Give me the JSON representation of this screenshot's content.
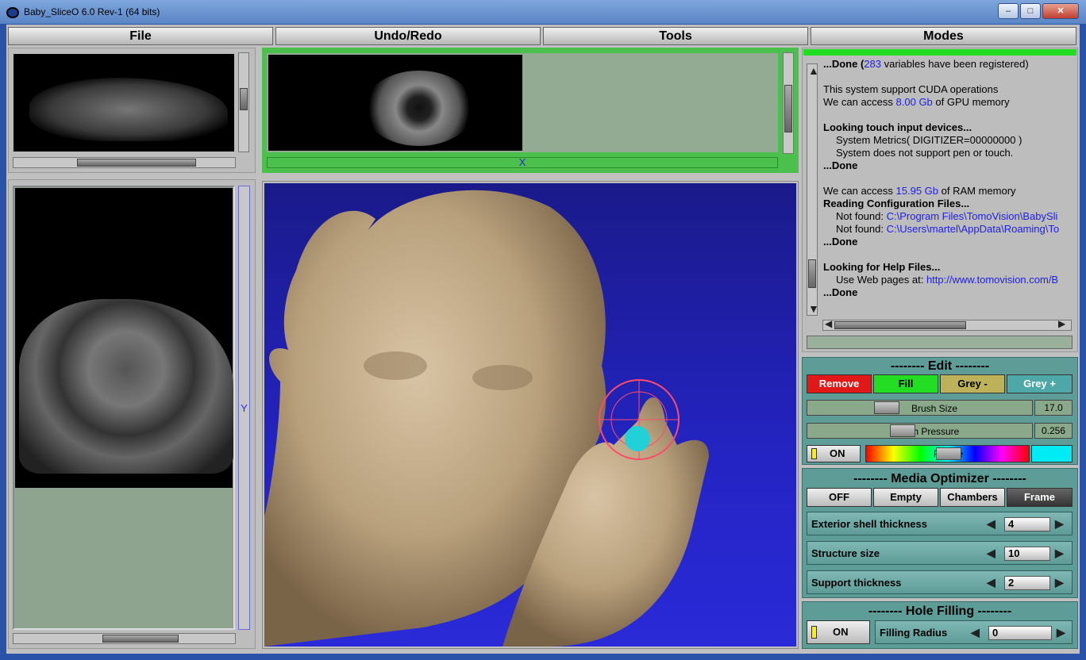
{
  "window": {
    "title": "Baby_SliceO 6.0 Rev-1 (64 bits)"
  },
  "menu": [
    "File",
    "Undo/Redo",
    "Tools",
    "Modes"
  ],
  "views": {
    "axis_y": "Y",
    "axis_x": "X"
  },
  "log": [
    {
      "bold": true,
      "text": "...Done (",
      "blue": "283",
      "rest": " variables have been registered)"
    },
    {
      "text": ""
    },
    {
      "text": "This system support CUDA operations"
    },
    {
      "text": "We can access ",
      "blue": "8.00 Gb",
      "rest": " of GPU memory"
    },
    {
      "text": ""
    },
    {
      "bold": true,
      "text": "Looking touch input devices..."
    },
    {
      "indent": true,
      "text": "System Metrics( DIGITIZER=00000000 )"
    },
    {
      "indent": true,
      "text": "System does not support pen or touch."
    },
    {
      "bold": true,
      "text": "...Done"
    },
    {
      "text": ""
    },
    {
      "text": "We can access ",
      "blue": "15.95 Gb",
      "rest": " of RAM memory"
    },
    {
      "bold": true,
      "text": "Reading Configuration Files..."
    },
    {
      "indent": true,
      "text": "Not found: ",
      "blue": "C:\\Program Files\\TomoVision\\BabySli"
    },
    {
      "indent": true,
      "text": "Not found: ",
      "blue": "C:\\Users\\martel\\AppData\\Roaming\\To"
    },
    {
      "bold": true,
      "text": "...Done"
    },
    {
      "text": ""
    },
    {
      "bold": true,
      "text": "Looking for Help Files..."
    },
    {
      "indent": true,
      "text": "Use Web pages at: ",
      "blue": "http://www.tomovision.com/B"
    },
    {
      "bold": true,
      "text": "...Done"
    }
  ],
  "edit": {
    "title": "-------- Edit --------",
    "buttons": [
      "Remove",
      "Fill",
      "Grey -",
      "Grey +"
    ],
    "brush_size_label": "Brush Size",
    "brush_size_value": "17.0",
    "brush_pressure_label": "Brush Pressure",
    "brush_pressure_value": "0.256",
    "on_label": "ON",
    "palette_label": "Palette"
  },
  "optimizer": {
    "title": "-------- Media Optimizer --------",
    "buttons": [
      "OFF",
      "Empty",
      "Chambers",
      "Frame"
    ],
    "params": [
      {
        "label": "Exterior shell thickness",
        "value": "4"
      },
      {
        "label": "Structure size",
        "value": "10"
      },
      {
        "label": "Support thickness",
        "value": "2"
      }
    ]
  },
  "hole": {
    "title": "-------- Hole Filling --------",
    "on_label": "ON",
    "radius_label": "Filling Radius",
    "radius_value": "0"
  },
  "colors": {
    "remove": "#e01818",
    "fill": "#22dd22",
    "grey_minus": "#bdb25a",
    "grey_plus": "#4ea8a8"
  }
}
